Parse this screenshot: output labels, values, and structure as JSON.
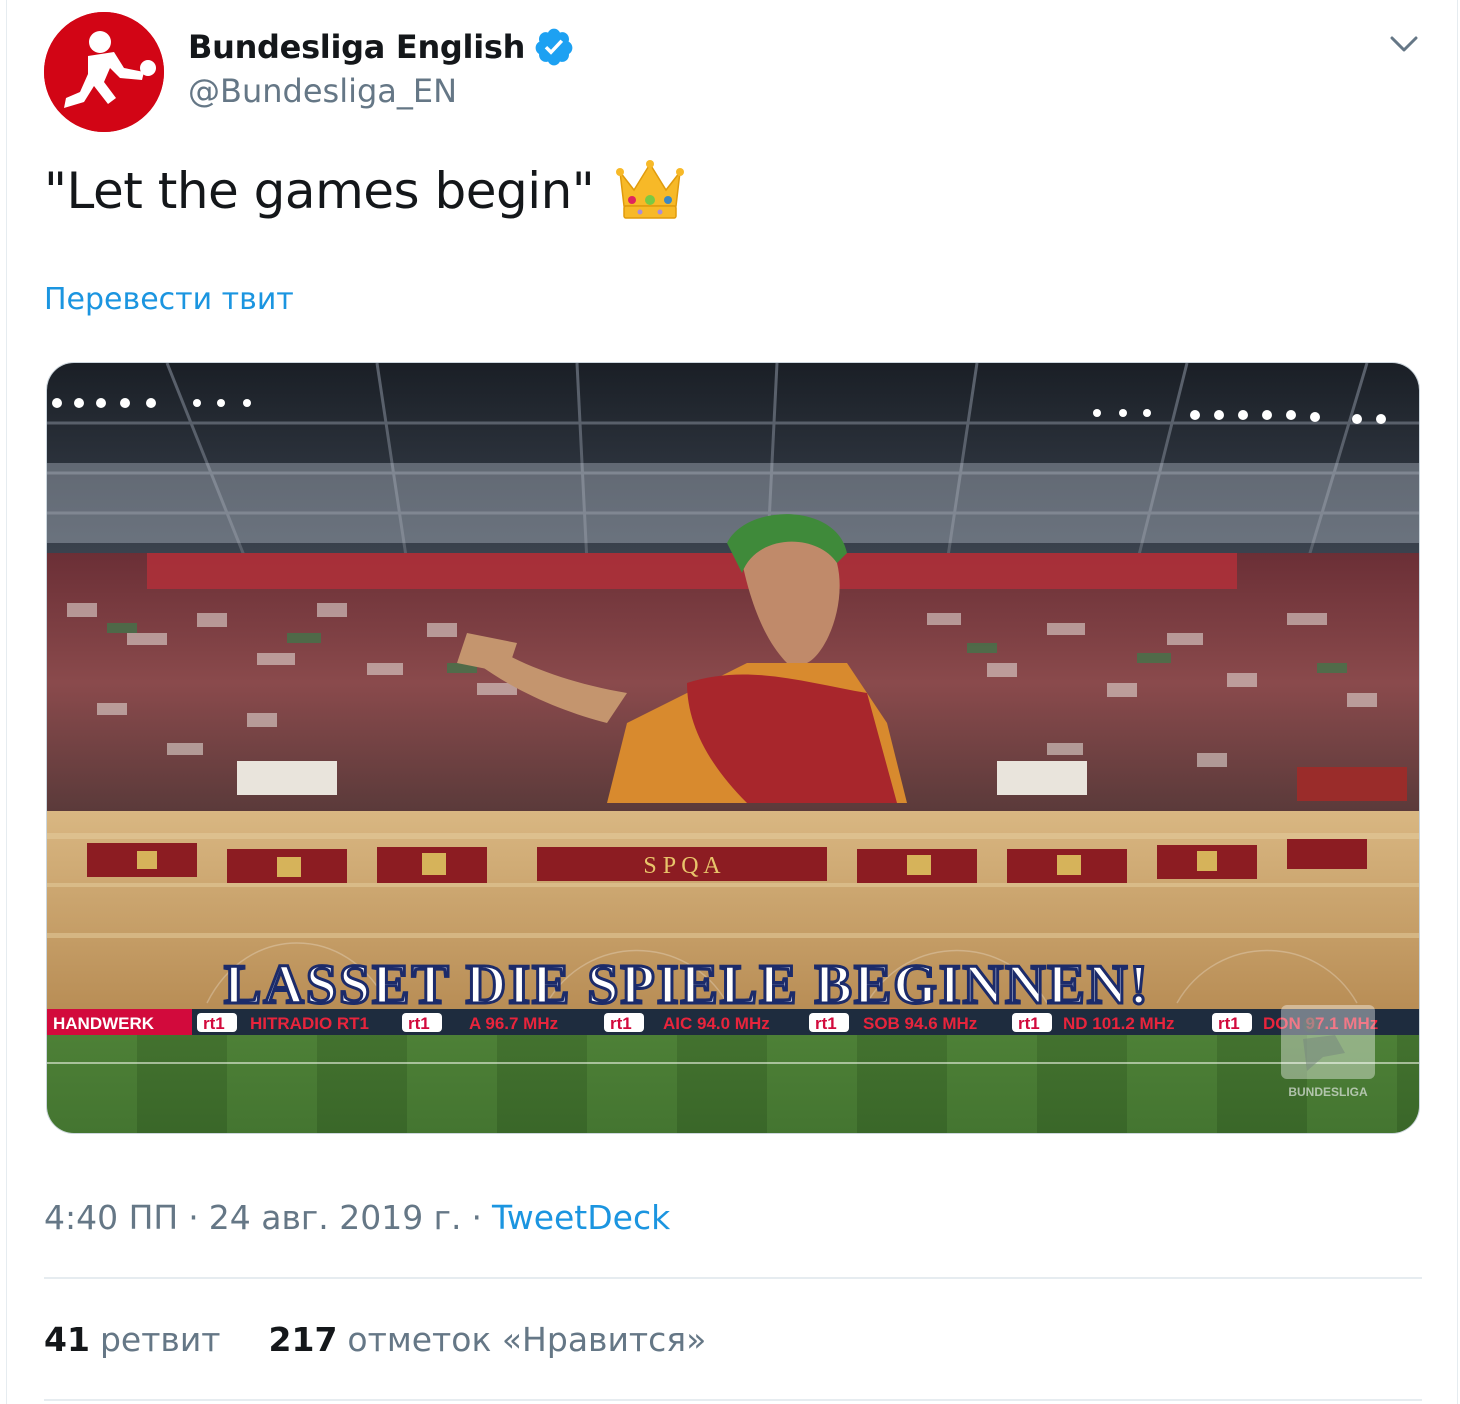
{
  "author": {
    "display_name": "Bundesliga English",
    "handle": "@Bundesliga_EN",
    "verified": true,
    "avatar_icon": "bundesliga-logo-icon",
    "brand_color": "#d20515"
  },
  "tweet": {
    "text": "\"Let the games begin\"",
    "emoji": "crown",
    "translate_label": "Перевести твит"
  },
  "media": {
    "banner_text": "LASSET DIE SPIELE BEGINNEN!",
    "plaque_text": "S P Q A",
    "ad_board": [
      "HANDWERK",
      "rt1",
      "HITRADIO RT1",
      "rt1",
      "A 96.7 MHz",
      "rt1",
      "AIC 94.0 MHz",
      "rt1",
      "SOB 94.6 MHz",
      "rt1",
      "ND 101.2 MHz",
      "rt1",
      "DON 97.1 MHz"
    ],
    "watermark": "BUNDESLIGA"
  },
  "meta": {
    "time": "4:40 ПП",
    "separator": "·",
    "date": "24 авг. 2019 г.",
    "source": "TweetDeck"
  },
  "stats": {
    "retweets_count": "41",
    "retweets_label": "ретвит",
    "likes_count": "217",
    "likes_label": "отметок «Нравится»"
  },
  "colors": {
    "link": "#1b95e0",
    "secondary_text": "#657786",
    "verified": "#1da1f2"
  }
}
